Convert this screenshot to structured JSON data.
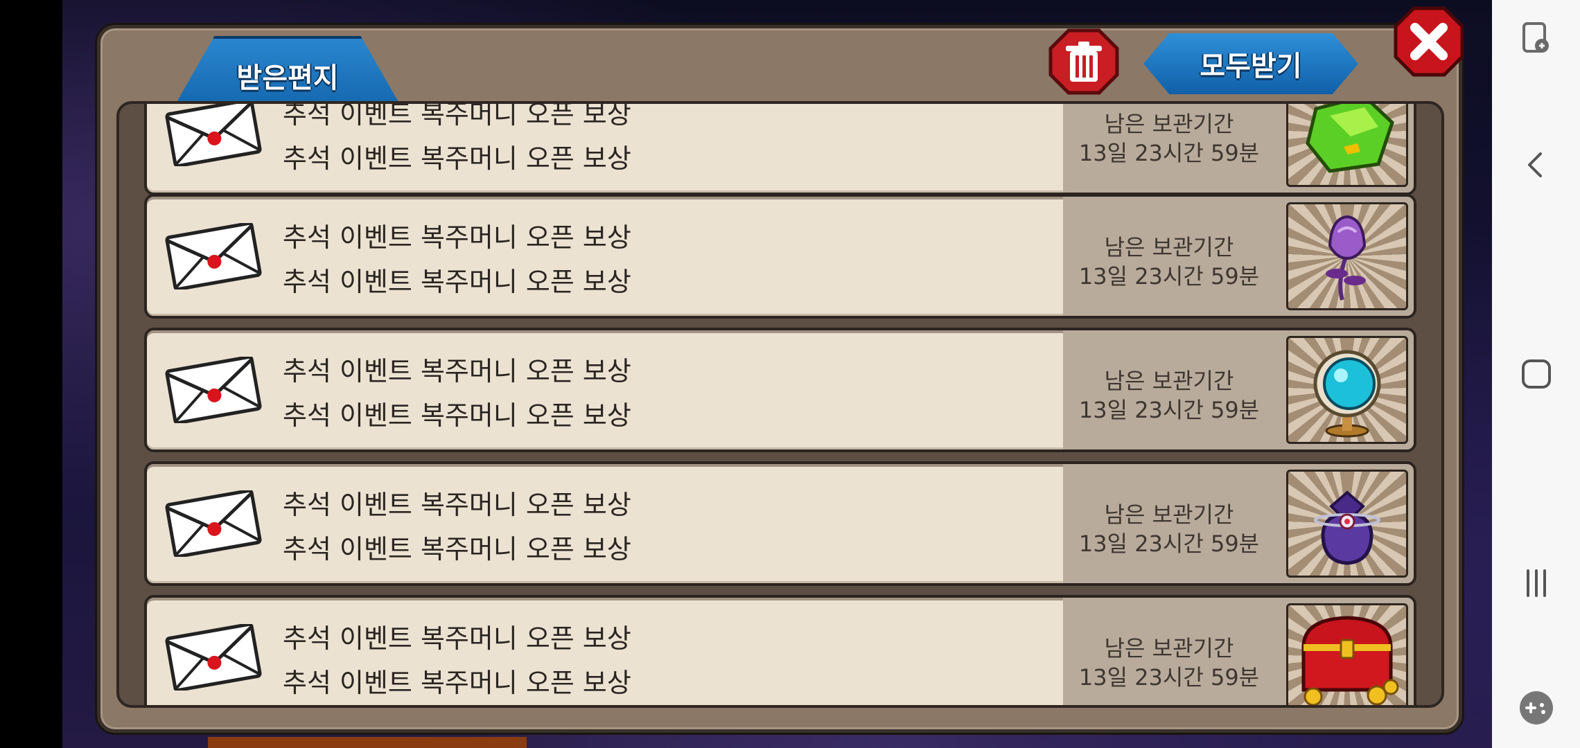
{
  "mailbox": {
    "tab_label": "받은편지",
    "receive_all_label": "모두받기",
    "trash_icon": "trash-icon",
    "close_icon": "close-icon",
    "colors": {
      "tab_blue": "#1a73b8",
      "trash_red": "#c81e24",
      "close_red": "#c8141c",
      "panel_brown": "#8b7866"
    },
    "mails": [
      {
        "title": "추석 이벤트 복주머니 오픈 보상",
        "body": "추석 이벤트 복주머니 오픈 보상",
        "expiry_label": "남은 보관기간",
        "expiry_value": "13일 23시간 59분",
        "item_icon": "green-gem-icon"
      },
      {
        "title": "추석 이벤트 복주머니 오픈 보상",
        "body": "추석 이벤트 복주머니 오픈 보상",
        "expiry_label": "남은 보관기간",
        "expiry_value": "13일 23시간 59분",
        "item_icon": "purple-flower-icon"
      },
      {
        "title": "추석 이벤트 복주머니 오픈 보상",
        "body": "추석 이벤트 복주머니 오픈 보상",
        "expiry_label": "남은 보관기간",
        "expiry_value": "13일 23시간 59분",
        "item_icon": "crystal-orb-icon"
      },
      {
        "title": "추석 이벤트 복주머니 오픈 보상",
        "body": "추석 이벤트 복주머니 오픈 보상",
        "expiry_label": "남은 보관기간",
        "expiry_value": "13일 23시간 59분",
        "item_icon": "purple-pouch-icon"
      },
      {
        "title": "추석 이벤트 복주머니 오픈 보상",
        "body": "추석 이벤트 복주머니 오픈 보상",
        "expiry_label": "남은 보관기간",
        "expiry_value": "13일 23시간 59분",
        "item_icon": "treasure-chest-icon"
      }
    ]
  },
  "android_nav": {
    "items": [
      "game-tools-icon",
      "back-icon",
      "home-icon",
      "recents-icon",
      "game-launcher-icon"
    ]
  }
}
